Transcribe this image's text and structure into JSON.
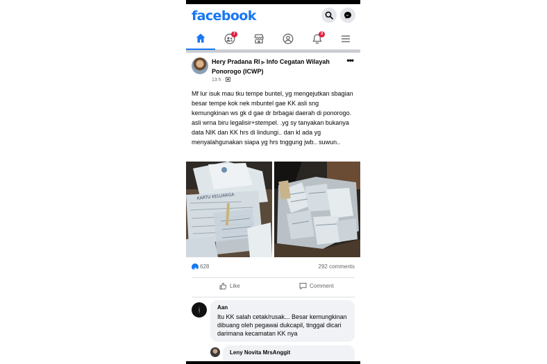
{
  "header": {
    "logo": "facebook"
  },
  "nav": {
    "items": [
      {
        "name": "home",
        "badge": ""
      },
      {
        "name": "friends",
        "badge": "7"
      },
      {
        "name": "marketplace",
        "badge": ""
      },
      {
        "name": "profile",
        "badge": ""
      },
      {
        "name": "notifications",
        "badge": "3"
      },
      {
        "name": "menu",
        "badge": ""
      }
    ]
  },
  "post": {
    "author": "Hery Pradana RI",
    "group": "Info Cegatan Wilayah Ponorogo (ICWP)",
    "time": "13 h ·",
    "text": "Mf lur isuk mau tku tempe buntel, yg mengejutkan sbagian besar tempe kok nek mbuntel gae KK asli sng kemungkinan ws gk d gae dr brbagai daerah di ponorogo. asli wrna biru legalisir+stempel. .yg sy tanyakan bukanya data NIK dan KK hrs di lindungi.. dan kl ada yg menyalahgunakan siapa yg hrs tnggung jwb.. suwun..",
    "photo_label": "KARTU KELUARGA",
    "likes": "628",
    "comments": "292 comments",
    "like_label": "Like",
    "comment_label": "Comment"
  },
  "comments": [
    {
      "name": "Aan",
      "text": "Itu KK salah cetak/rusak... Besar kemungkinan dibuang oleh pegawai dukcapil, tinggal dicari darimana kecamatan KK nya"
    },
    {
      "name": "Leny Novita MrsAnggit",
      "text": ""
    }
  ],
  "colors": {
    "brand": "#1877f2",
    "badge": "#e41e3f",
    "muted": "#65676b",
    "bubble": "#f0f2f5"
  }
}
